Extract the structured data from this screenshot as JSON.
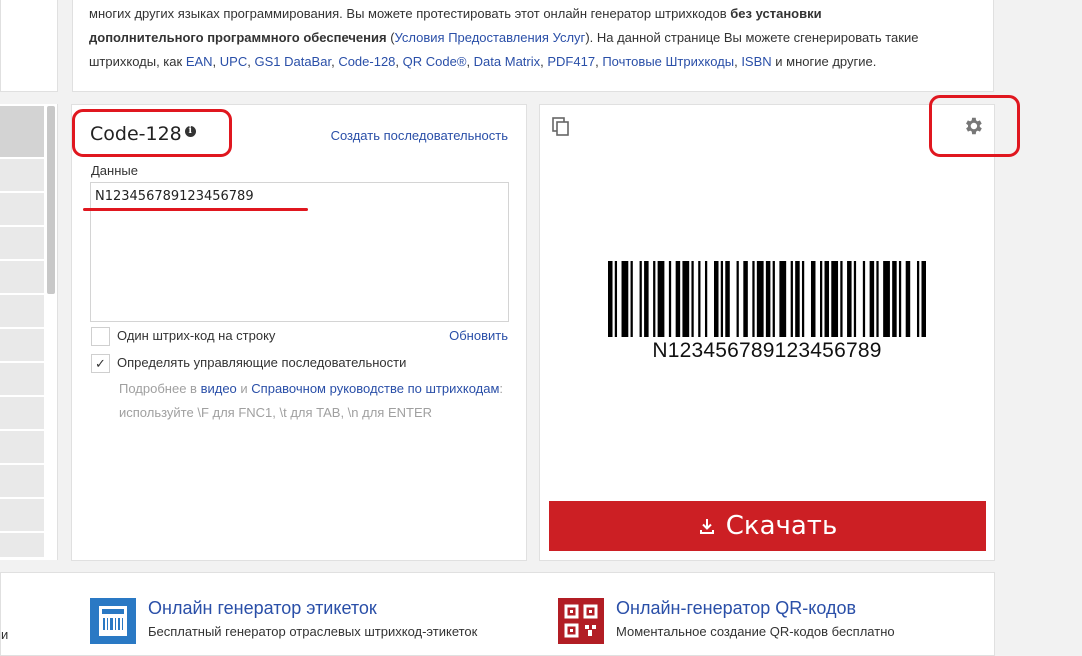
{
  "intro": {
    "line1": "многих других языках программирования. Вы можете протестировать этот онлайн генератор штрихкодов",
    "line1_bold": "без установки",
    "line2_bold": "дополнительного программного обеспечения",
    "line2_open": " (",
    "terms_link": "Условия Предоставления Услуг",
    "line2_rest": "). На данной странице Вы можете сгенерировать такие",
    "line3_prefix": "штрихкоды, как ",
    "links": [
      "EAN",
      "UPC",
      "GS1 DataBar",
      "Code-128",
      "QR Code®",
      "Data Matrix",
      "PDF417",
      "Почтовые Штрихкоды",
      "ISBN"
    ],
    "line3_suffix": " и многие другие."
  },
  "form": {
    "symbology_title": "Code-128",
    "info_glyph": "i",
    "sequence_link": "Создать последовательность",
    "data_label": "Данные",
    "data_value": "N123456789123456789",
    "one_per_line_label": "Один штрих-код на строку",
    "update_link": "Обновить",
    "escape_label": "Определять управляющие последовательности",
    "escape_checked_glyph": "✓",
    "hint_prefix": "Подробнее в ",
    "hint_video": "видео",
    "hint_and": " и ",
    "hint_guide": "Справочном руководстве по штрихкодам",
    "hint_rest": ": используйте \\F для FNC1, \\t для TAB, \\n для ENTER"
  },
  "preview": {
    "barcode_text": "N123456789123456789",
    "download_label": "Скачать",
    "accent_color": "#cc1f24"
  },
  "bottom": {
    "cut_text": "и",
    "products": [
      {
        "title": "Онлайн генератор этикеток",
        "desc": "Бесплатный генератор отраслевых штрихкод-этикеток",
        "icon": "label-icon"
      },
      {
        "title": "Онлайн-генератор QR-кодов",
        "desc": "Моментальное создание QR-кодов бесплатно",
        "icon": "qr-code-icon"
      }
    ]
  },
  "annotation_color": "#e0171f"
}
